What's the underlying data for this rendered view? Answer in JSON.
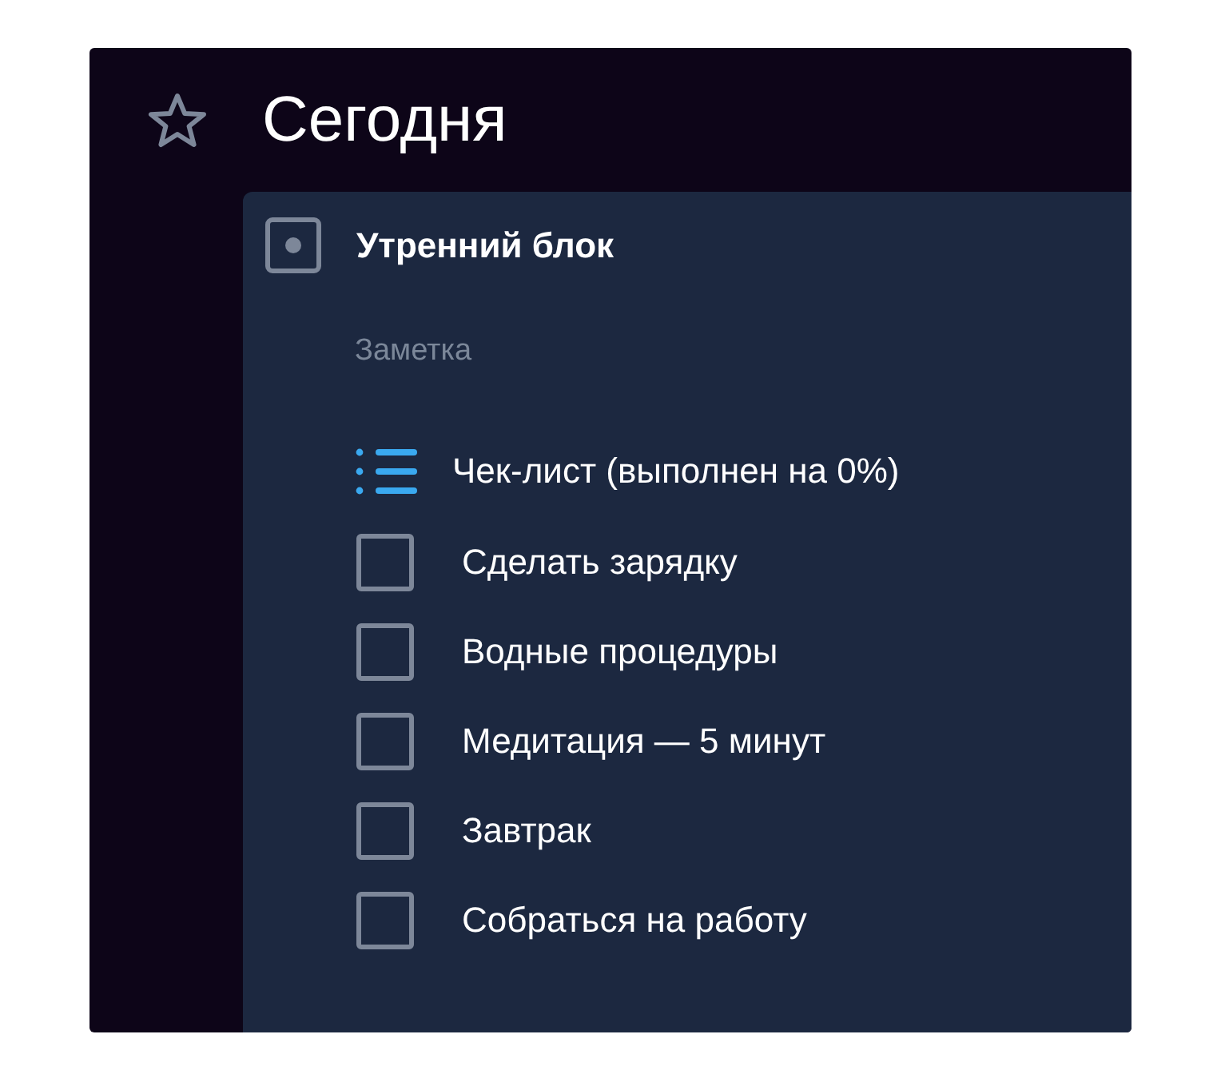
{
  "header": {
    "title": "Сегодня",
    "starred": false
  },
  "task": {
    "title": "Утренний блок",
    "note_placeholder": "Заметка",
    "checklist": {
      "title": "Чек-лист (выполнен на 0%)",
      "items": [
        {
          "label": "Сделать зарядку",
          "checked": false
        },
        {
          "label": "Водные процедуры",
          "checked": false
        },
        {
          "label": "Медитация — 5 минут",
          "checked": false
        },
        {
          "label": "Завтрак",
          "checked": false
        },
        {
          "label": "Собраться на работу",
          "checked": false
        }
      ]
    }
  }
}
